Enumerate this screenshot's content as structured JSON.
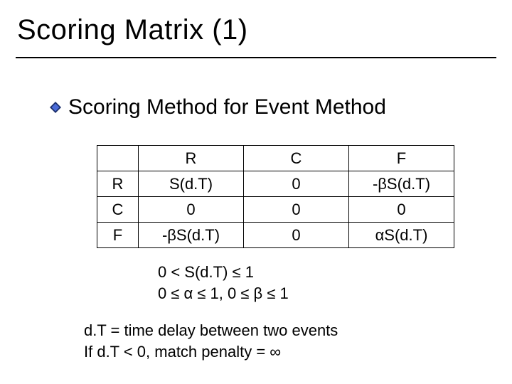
{
  "title": "Scoring Matrix (1)",
  "bullet": "Scoring Method for Event Method",
  "table": {
    "col_headers": [
      "R",
      "C",
      "F"
    ],
    "row_headers": [
      "R",
      "C",
      "F"
    ],
    "cells": [
      [
        "S(d.T)",
        "0",
        "-βS(d.T)"
      ],
      [
        "0",
        "0",
        "0"
      ],
      [
        "-βS(d.T)",
        "0",
        "αS(d.T)"
      ]
    ]
  },
  "constraints": {
    "line1": "0 < S(d.T) ≤ 1",
    "line2": "0 ≤ α ≤ 1, 0 ≤ β ≤ 1"
  },
  "notes": {
    "line1": "d.T = time delay between two events",
    "line2": "If d.T < 0, match penalty = ∞"
  }
}
